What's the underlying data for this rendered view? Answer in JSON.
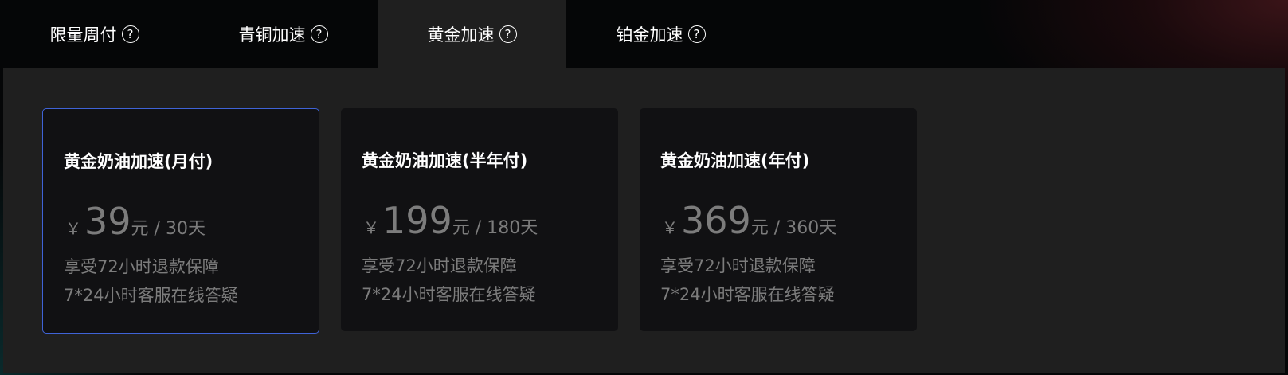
{
  "tabs": [
    {
      "label": "限量周付",
      "help": "?"
    },
    {
      "label": "青铜加速",
      "help": "?"
    },
    {
      "label": "黄金加速",
      "help": "?"
    },
    {
      "label": "铂金加速",
      "help": "?"
    }
  ],
  "active_tab": "黄金加速",
  "plans": [
    {
      "title": "黄金奶油加速(月付)",
      "currency": "￥",
      "price": "39",
      "unit": "元 / 30天",
      "features": [
        "享受72小时退款保障",
        "7*24小时客服在线答疑"
      ],
      "selected": true
    },
    {
      "title": "黄金奶油加速(半年付)",
      "currency": "￥",
      "price": "199",
      "unit": "元 / 180天",
      "features": [
        "享受72小时退款保障",
        "7*24小时客服在线答疑"
      ],
      "selected": false
    },
    {
      "title": "黄金奶油加速(年付)",
      "currency": "￥",
      "price": "369",
      "unit": "元 / 360天",
      "features": [
        "享受72小时退款保障",
        "7*24小时客服在线答疑"
      ],
      "selected": false
    }
  ],
  "colors": {
    "selected_border": "#3f63d6",
    "panel_bg": "#1f1f1f",
    "card_bg": "#111113",
    "muted_text": "#7c7c7c"
  }
}
